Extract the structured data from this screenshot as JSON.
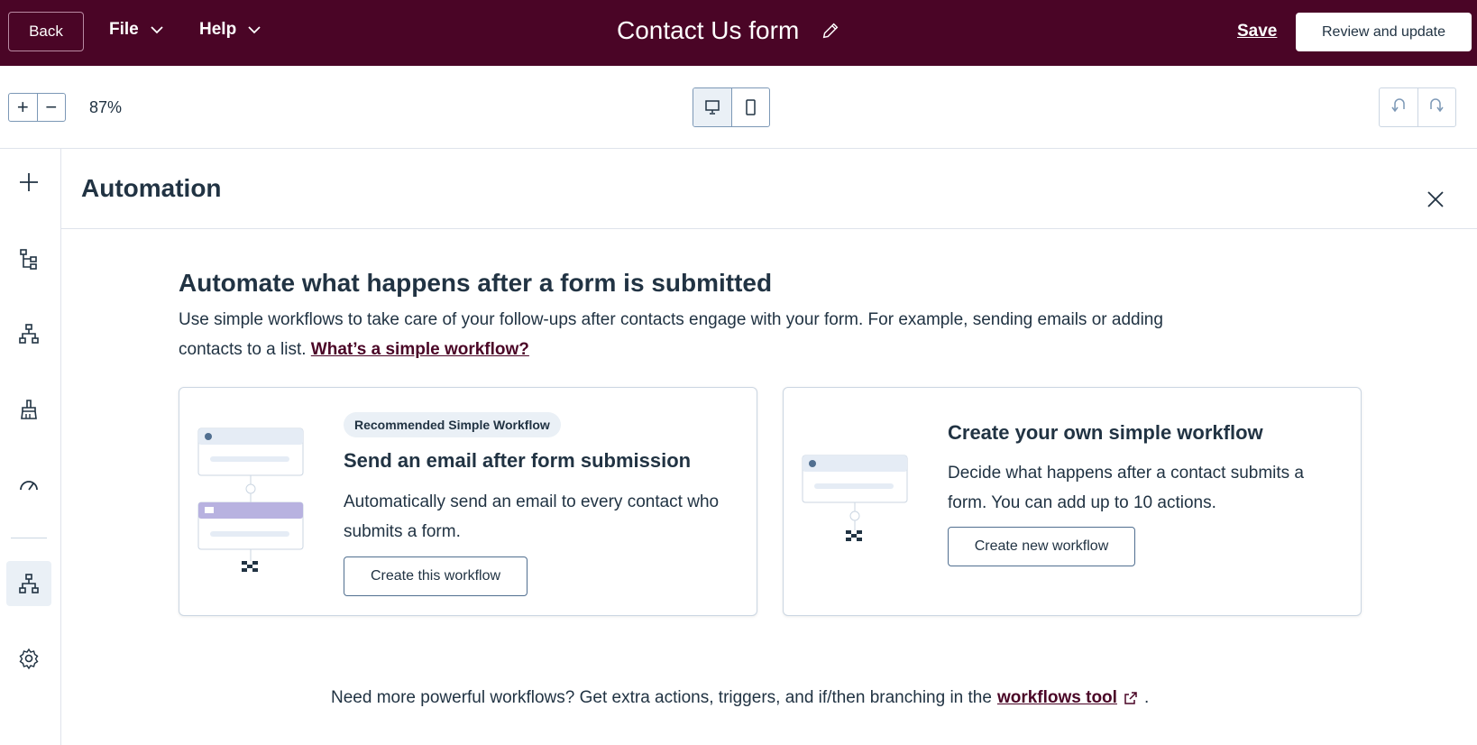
{
  "header": {
    "back_label": "Back",
    "file_label": "File",
    "help_label": "Help",
    "title": "Contact Us form",
    "save_label": "Save",
    "review_label": "Review and update"
  },
  "toolbar": {
    "zoom_in": "+",
    "zoom_out": "−",
    "zoom_level": "87%"
  },
  "panel": {
    "title": "Automation",
    "heading": "Automate what happens after a form is submitted",
    "description": "Use simple workflows to take care of your follow-ups after contacts engage with your form. For example, sending emails or adding contacts to a list.",
    "description_link": "What’s a simple workflow?",
    "cards": [
      {
        "badge": "Recommended Simple Workflow",
        "title": "Send an email after form submission",
        "text": "Automatically send an email to every contact who submits a form.",
        "button": "Create this workflow"
      },
      {
        "title": "Create your own simple workflow",
        "text": "Decide what happens after a contact submits a form. You can add up to 10 actions.",
        "button": "Create new workflow"
      }
    ],
    "footer_text": "Need more powerful workflows? Get extra actions, triggers, and if/then branching in the",
    "footer_link": "workflows tool",
    "footer_suffix": "."
  },
  "colors": {
    "brand": "#4a0526",
    "text": "#213343",
    "border": "#cbd6e2",
    "active_bg": "#eaf0f6"
  }
}
